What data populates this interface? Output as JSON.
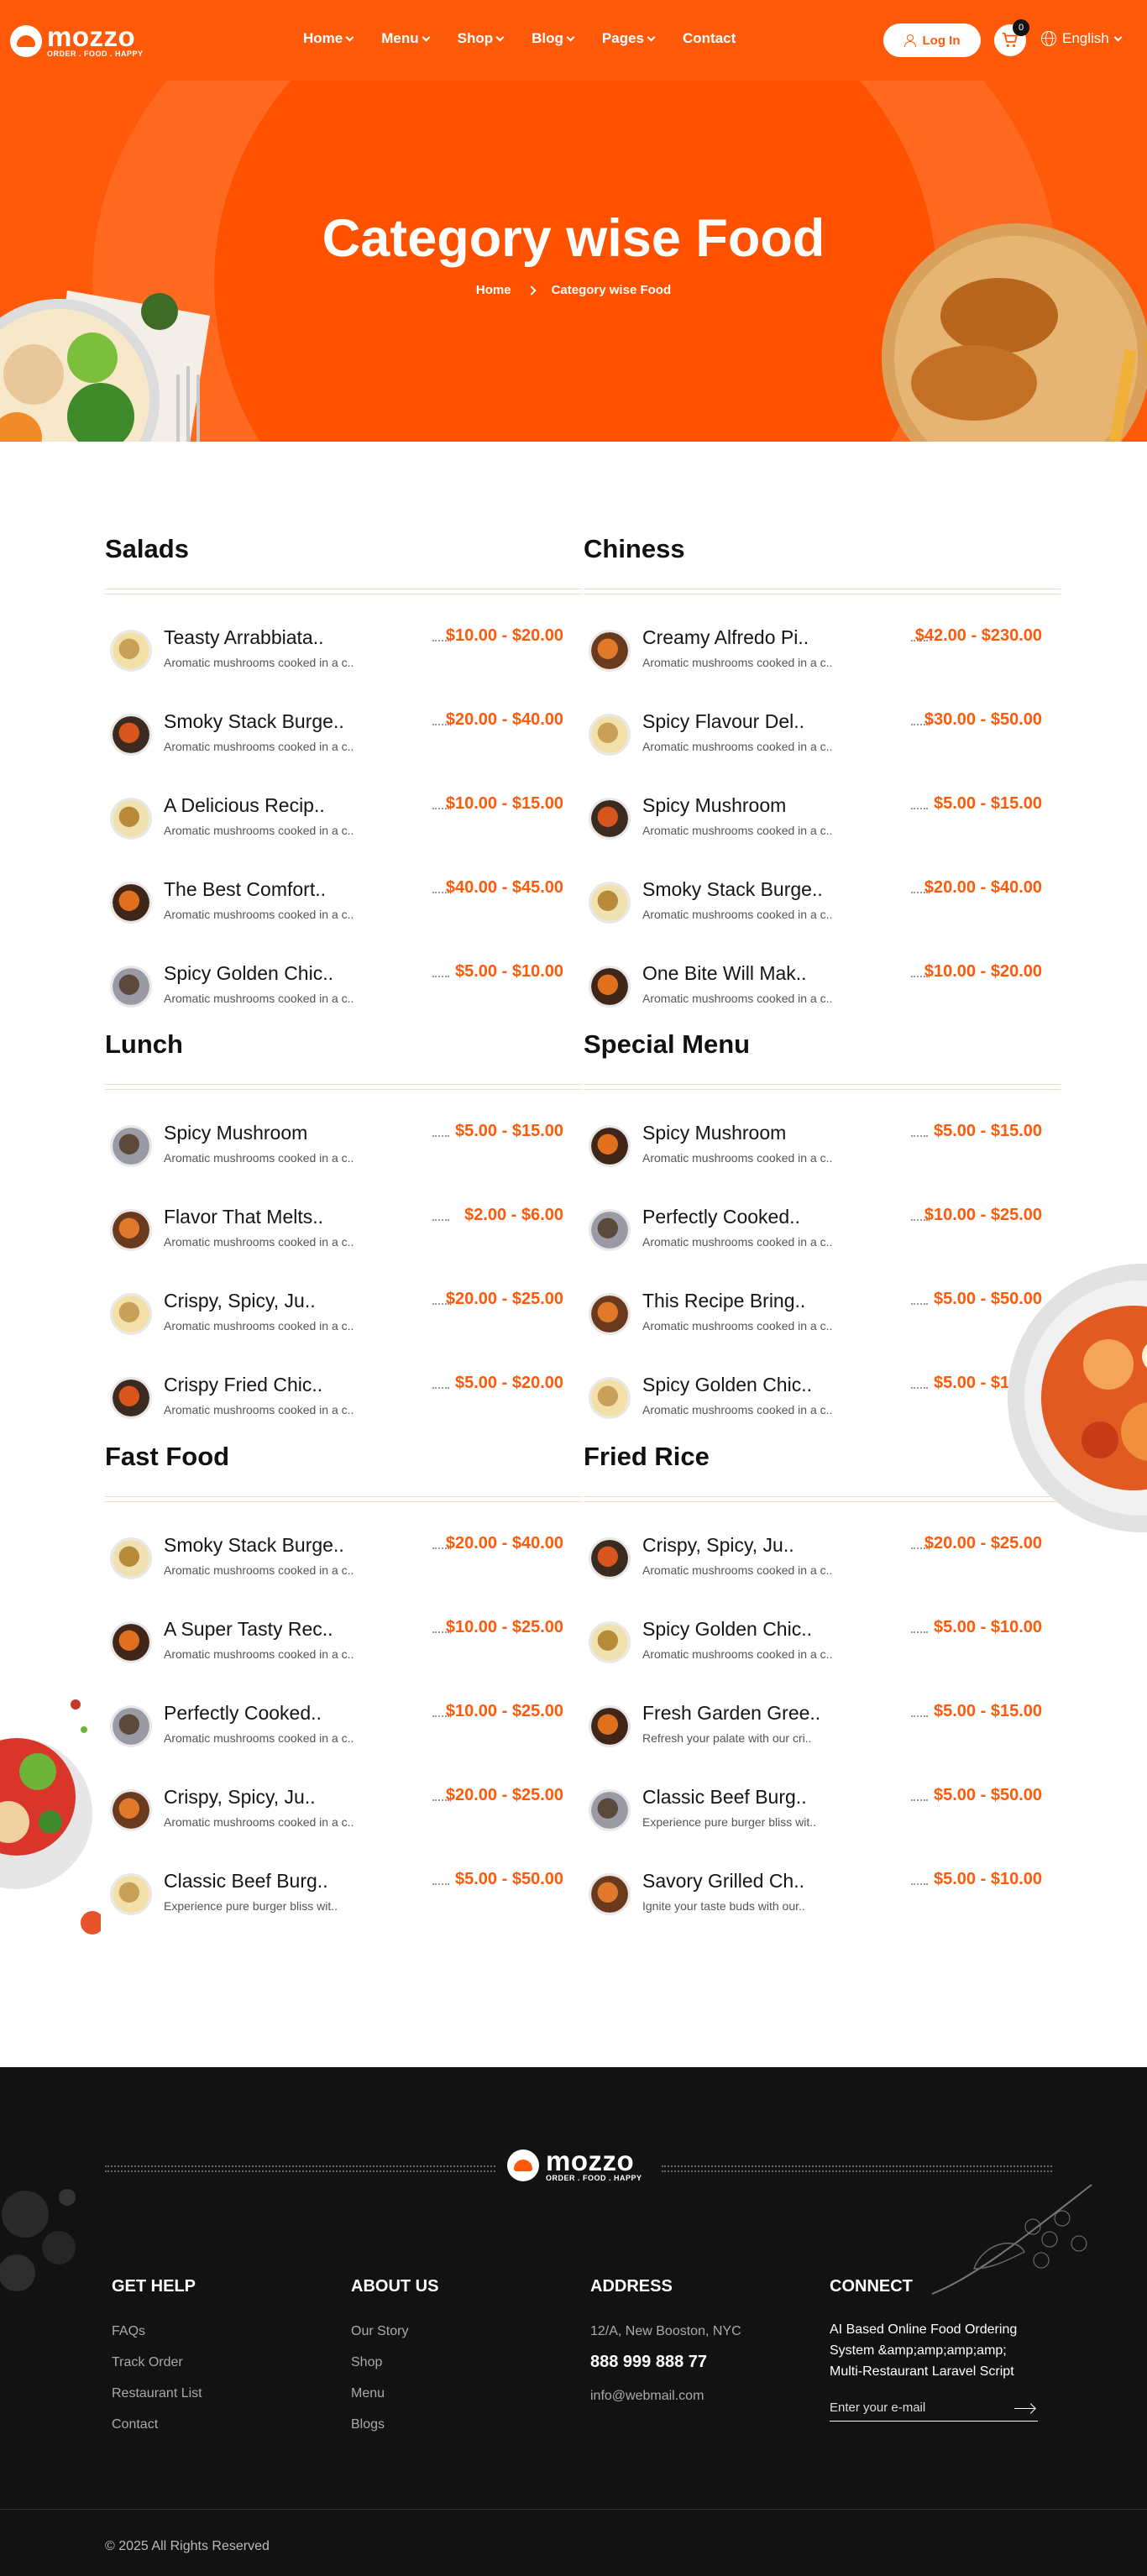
{
  "header": {
    "logo_name": "mozzo",
    "logo_tagline": "ORDER . FOOD . HAPPY",
    "nav": [
      "Home",
      "Menu",
      "Shop",
      "Blog",
      "Pages",
      "Contact"
    ],
    "login_label": "Log In",
    "cart_count": "0",
    "language": "English"
  },
  "hero": {
    "title": "Category wise Food",
    "breadcrumb_home": "Home",
    "breadcrumb_current": "Category wise Food"
  },
  "sections": [
    {
      "title": "Salads",
      "items": [
        {
          "name": "Teasty Arrabbiata..",
          "desc": "Aromatic mushrooms cooked in a c..",
          "price": "$10.00 - $20.00"
        },
        {
          "name": "Smoky Stack Burge..",
          "desc": "Aromatic mushrooms cooked in a c..",
          "price": "$20.00 - $40.00"
        },
        {
          "name": "A Delicious Recip..",
          "desc": "Aromatic mushrooms cooked in a c..",
          "price": "$10.00 - $15.00"
        },
        {
          "name": "The Best Comfort..",
          "desc": "Aromatic mushrooms cooked in a c..",
          "price": "$40.00 - $45.00"
        },
        {
          "name": "Spicy Golden Chic..",
          "desc": "Aromatic mushrooms cooked in a c..",
          "price": "$5.00 - $10.00"
        }
      ]
    },
    {
      "title": "Chiness",
      "items": [
        {
          "name": "Creamy Alfredo Pi..",
          "desc": "Aromatic mushrooms cooked in a c..",
          "price": "$42.00 - $230.00"
        },
        {
          "name": "Spicy Flavour Del..",
          "desc": "Aromatic mushrooms cooked in a c..",
          "price": "$30.00 - $50.00"
        },
        {
          "name": "Spicy Mushroom",
          "desc": "Aromatic mushrooms cooked in a c..",
          "price": "$5.00 - $15.00"
        },
        {
          "name": "Smoky Stack Burge..",
          "desc": "Aromatic mushrooms cooked in a c..",
          "price": "$20.00 - $40.00"
        },
        {
          "name": "One Bite Will Mak..",
          "desc": "Aromatic mushrooms cooked in a c..",
          "price": "$10.00 - $20.00"
        }
      ]
    },
    {
      "title": "Lunch",
      "items": [
        {
          "name": "Spicy Mushroom",
          "desc": "Aromatic mushrooms cooked in a c..",
          "price": "$5.00 - $15.00"
        },
        {
          "name": "Flavor That Melts..",
          "desc": "Aromatic mushrooms cooked in a c..",
          "price": "$2.00 - $6.00"
        },
        {
          "name": "Crispy, Spicy, Ju..",
          "desc": "Aromatic mushrooms cooked in a c..",
          "price": "$20.00 - $25.00"
        },
        {
          "name": "Crispy Fried Chic..",
          "desc": "Aromatic mushrooms cooked in a c..",
          "price": "$5.00 - $20.00"
        }
      ]
    },
    {
      "title": "Special Menu",
      "items": [
        {
          "name": "Spicy Mushroom",
          "desc": "Aromatic mushrooms cooked in a c..",
          "price": "$5.00 - $15.00"
        },
        {
          "name": "Perfectly Cooked..",
          "desc": "Aromatic mushrooms cooked in a c..",
          "price": "$10.00 - $25.00"
        },
        {
          "name": "This Recipe Bring..",
          "desc": "Aromatic mushrooms cooked in a c..",
          "price": "$5.00 - $50.00"
        },
        {
          "name": "Spicy Golden Chic..",
          "desc": "Aromatic mushrooms cooked in a c..",
          "price": "$5.00 - $10.00"
        }
      ]
    },
    {
      "title": "Fast Food",
      "items": [
        {
          "name": "Smoky Stack Burge..",
          "desc": "Aromatic mushrooms cooked in a c..",
          "price": "$20.00 - $40.00"
        },
        {
          "name": "A Super Tasty Rec..",
          "desc": "Aromatic mushrooms cooked in a c..",
          "price": "$10.00 - $25.00"
        },
        {
          "name": "Perfectly Cooked..",
          "desc": "Aromatic mushrooms cooked in a c..",
          "price": "$10.00 - $25.00"
        },
        {
          "name": "Crispy, Spicy, Ju..",
          "desc": "Aromatic mushrooms cooked in a c..",
          "price": "$20.00 - $25.00"
        },
        {
          "name": "Classic Beef Burg..",
          "desc": "Experience pure burger bliss wit..",
          "price": "$5.00 - $50.00"
        }
      ]
    },
    {
      "title": "Fried Rice",
      "items": [
        {
          "name": "Crispy, Spicy, Ju..",
          "desc": "Aromatic mushrooms cooked in a c..",
          "price": "$20.00 - $25.00"
        },
        {
          "name": "Spicy Golden Chic..",
          "desc": "Aromatic mushrooms cooked in a c..",
          "price": "$5.00 - $10.00"
        },
        {
          "name": "Fresh Garden Gree..",
          "desc": "Refresh your palate with our cri..",
          "price": "$5.00 - $15.00"
        },
        {
          "name": "Classic Beef Burg..",
          "desc": "Experience pure burger bliss wit..",
          "price": "$5.00 - $50.00"
        },
        {
          "name": "Savory Grilled Ch..",
          "desc": "Ignite your taste buds with our..",
          "price": "$5.00 - $10.00"
        }
      ]
    }
  ],
  "footer": {
    "get_help_title": "GET HELP",
    "get_help_links": [
      "FAQs",
      "Track Order",
      "Restaurant List",
      "Contact"
    ],
    "about_title": "ABOUT US",
    "about_links": [
      "Our Story",
      "Shop",
      "Menu",
      "Blogs"
    ],
    "address_title": "ADDRESS",
    "address_line": "12/A, New Booston, NYC",
    "phone": "888 999 888 77",
    "email": "info@webmail.com",
    "connect_title": "CONNECT",
    "connect_desc": "AI Based Online Food Ordering System &amp;amp;amp;amp; Multi-Restaurant Laravel Script",
    "email_placeholder": "Enter your e-mail",
    "copyright": "© 2025 All Rights Reserved"
  },
  "colors": {
    "accent": "#FF5A0A",
    "footer_bg": "#121212"
  },
  "icons": [
    "user-icon",
    "cart-icon",
    "globe-icon",
    "chevron-down-icon",
    "chevron-right-icon",
    "arrow-right-icon"
  ]
}
